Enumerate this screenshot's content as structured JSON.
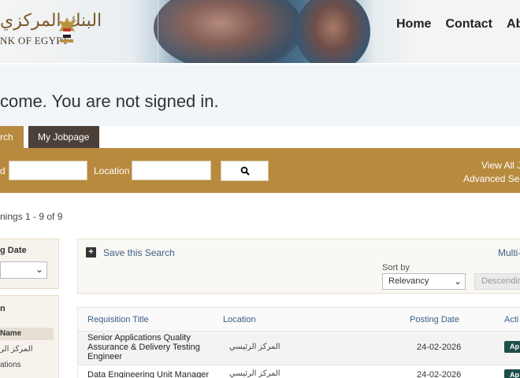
{
  "header": {
    "logo_arabic": "البنك المركزي",
    "logo_english": "NK OF EGYPT",
    "nav": [
      "Home",
      "Contact",
      "Ab"
    ]
  },
  "welcome": "come. You are not signed in.",
  "tabs": {
    "search": "rch",
    "myjobpage": "My Jobpage"
  },
  "searchbar": {
    "keyword_label": "d",
    "location_label": "Location",
    "view_all": "View All J",
    "advanced": "Advanced Sea"
  },
  "openings": "nings 1 - 9 of 9",
  "filters": {
    "posting_date_title": "g Date",
    "location_title": "n",
    "name_col": "Name",
    "items": [
      "المركز الر",
      "ations"
    ]
  },
  "results": {
    "save_search": "Save this Search",
    "multi": "Multi-",
    "sort_by_label": "Sort by",
    "sort_value": "Relevancy",
    "sort_dir": "Descendin"
  },
  "table": {
    "headers": {
      "title": "Requisition Title",
      "location": "Location",
      "date": "Posting Date",
      "action": "Acti"
    },
    "rows": [
      {
        "title": "Senior Applications Quality Assurance & Delivery Testing Engineer",
        "location": "المركز الرئيسي",
        "date": "24-02-2026",
        "action": "Ap"
      },
      {
        "title": "Data Engineering Unit Manager",
        "location": "المركز الرئيسي",
        "date": "24-02-2026",
        "action": "Ap"
      }
    ]
  },
  "colors": {
    "gold": "#b88a3e",
    "dark_tab": "#4a4038",
    "apply": "#1e4d4a",
    "link": "#3a5f86"
  }
}
